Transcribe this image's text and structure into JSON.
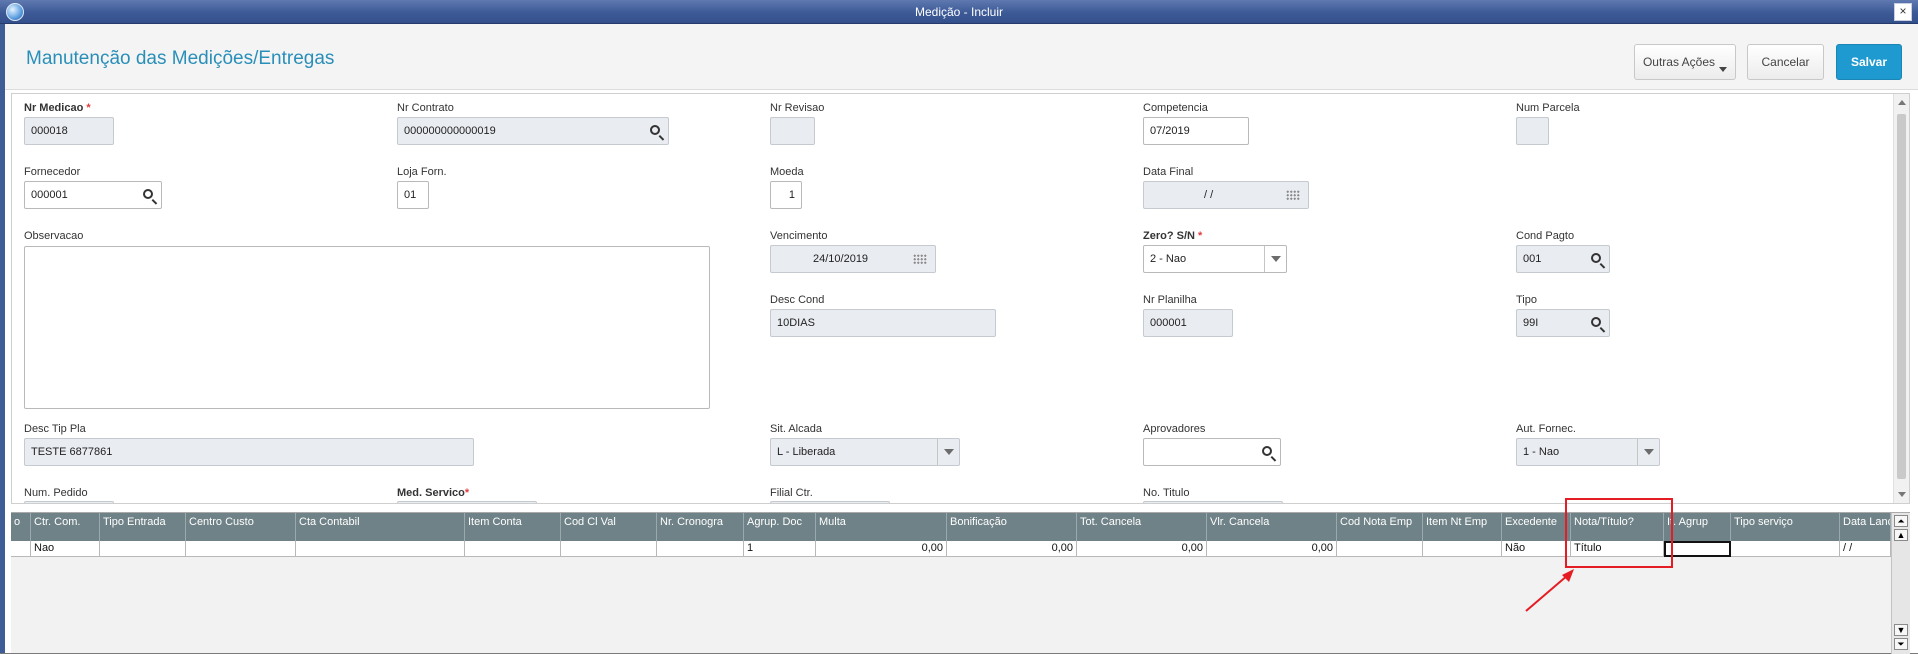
{
  "window": {
    "title": "Medição - Incluir",
    "close_label": "×"
  },
  "header": {
    "page_title": "Manutenção das Medições/Entregas",
    "buttons": {
      "other_actions": "Outras Ações",
      "cancel": "Cancelar",
      "save": "Salvar"
    }
  },
  "form": {
    "nr_medicao": {
      "label": "Nr Medicao",
      "required": "*",
      "value": "000018"
    },
    "nr_contrato": {
      "label": "Nr Contrato",
      "value": "000000000000019"
    },
    "nr_revisao": {
      "label": "Nr Revisao",
      "value": ""
    },
    "competencia": {
      "label": "Competencia",
      "value": "07/2019"
    },
    "num_parcela": {
      "label": "Num Parcela",
      "value": ""
    },
    "fornecedor": {
      "label": "Fornecedor",
      "value": "000001"
    },
    "loja_forn": {
      "label": "Loja Forn.",
      "value": "01"
    },
    "moeda": {
      "label": "Moeda",
      "value": "1"
    },
    "data_final": {
      "label": "Data Final",
      "value": "/ /"
    },
    "observacao": {
      "label": "Observacao",
      "value": ""
    },
    "vencimento": {
      "label": "Vencimento",
      "value": "24/10/2019"
    },
    "zero": {
      "label": "Zero? S/N",
      "required": "*",
      "value": "2 - Nao"
    },
    "cond_pagto": {
      "label": "Cond Pagto",
      "value": "001"
    },
    "desc_cond": {
      "label": "Desc Cond",
      "value": "10DIAS"
    },
    "nr_planilha": {
      "label": "Nr Planilha",
      "value": "000001"
    },
    "tipo": {
      "label": "Tipo",
      "value": "99I"
    },
    "desc_tip_pla": {
      "label": "Desc Tip Pla",
      "value": "TESTE 6877861"
    },
    "sit_alcada": {
      "label": "Sit. Alcada",
      "value": "L - Liberada"
    },
    "aprovadores": {
      "label": "Aprovadores",
      "value": ""
    },
    "aut_fornec": {
      "label": "Aut. Fornec.",
      "value": "1 - Nao"
    },
    "num_pedido": {
      "label": "Num. Pedido"
    },
    "med_servico": {
      "label": "Med. Servico",
      "required": "*"
    },
    "filial_ctr": {
      "label": "Filial Ctr."
    },
    "no_titulo": {
      "label": "No. Titulo"
    }
  },
  "grid": {
    "columns": [
      "o",
      "Ctr. Com.",
      "Tipo Entrada",
      "Centro Custo",
      "Cta Contabil",
      "Item Conta",
      "Cod Cl Val",
      "Nr. Cronogra",
      "Agrup. Doc",
      "Multa",
      "Bonificação",
      "Tot. Cancela",
      "Vlr. Cancela",
      "Cod Nota Emp",
      "Item Nt Emp",
      "Excedente",
      "Nota/Título?",
      "It. Agrup",
      "Tipo serviço",
      "Data Lanc."
    ],
    "rows": [
      [
        "",
        "Nao",
        "",
        "",
        "",
        "",
        "",
        "",
        "1",
        "0,00",
        "0,00",
        "0,00",
        "0,00",
        "",
        "",
        "Não",
        "Título",
        "",
        "",
        "/ /"
      ]
    ]
  },
  "colors": {
    "accent": "#1f9ad0",
    "grid_header": "#6f8287",
    "highlight": "#e51c23"
  }
}
